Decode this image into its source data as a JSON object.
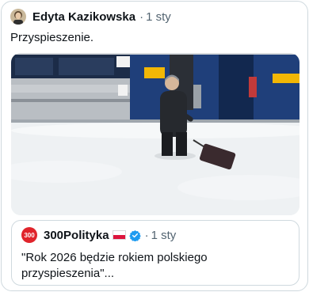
{
  "post": {
    "author": "Edyta Kazikowska",
    "separator": "·",
    "time": "1 sty",
    "text": "Przyspieszenie."
  },
  "quoted_post": {
    "avatar_text": "300",
    "author": "300Polityka",
    "separator": "·",
    "time": "1 sty",
    "text": "\"Rok 2026 będzie rokiem polskiego przyspieszenia\"..."
  },
  "icons": {
    "flag": "poland-flag-icon",
    "verified": "verified-badge-icon"
  },
  "colors": {
    "name": "#0f1419",
    "meta": "#536471",
    "border": "#cfd9de",
    "verified_blue": "#1d9bf0",
    "brand_red": "#e0242b",
    "train_blue": "#1f3f7a",
    "train_yellow": "#f2b705"
  }
}
